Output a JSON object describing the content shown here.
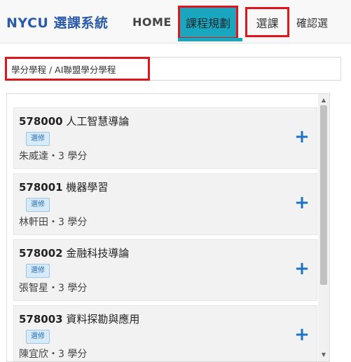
{
  "navbar": {
    "brand": "NYCU 選課系統",
    "home": "HOME",
    "plan": "課程規劃",
    "select": "選課",
    "confirm": "確認選"
  },
  "breadcrumb": {
    "text": "學分學程 / AI聯盟學分學程"
  },
  "courses": [
    {
      "code": "578000",
      "name": "人工智慧導論",
      "tag": "選修",
      "meta": "朱威達・3 學分"
    },
    {
      "code": "578001",
      "name": "機器學習",
      "tag": "選修",
      "meta": "林軒田・3 學分"
    },
    {
      "code": "578002",
      "name": "金融科技導論",
      "tag": "選修",
      "meta": "張智星・3 學分"
    },
    {
      "code": "578003",
      "name": "資料探勘與應用",
      "tag": "選修",
      "meta": "陳宜欣・3 學分"
    }
  ],
  "icons": {
    "add": "+",
    "scroll_up": "▲",
    "scroll_down": "▼"
  },
  "colors": {
    "accent": "#19a7c0",
    "highlight": "#e0161c",
    "brand": "#2a5aa8",
    "add_button": "#1f73c4"
  }
}
